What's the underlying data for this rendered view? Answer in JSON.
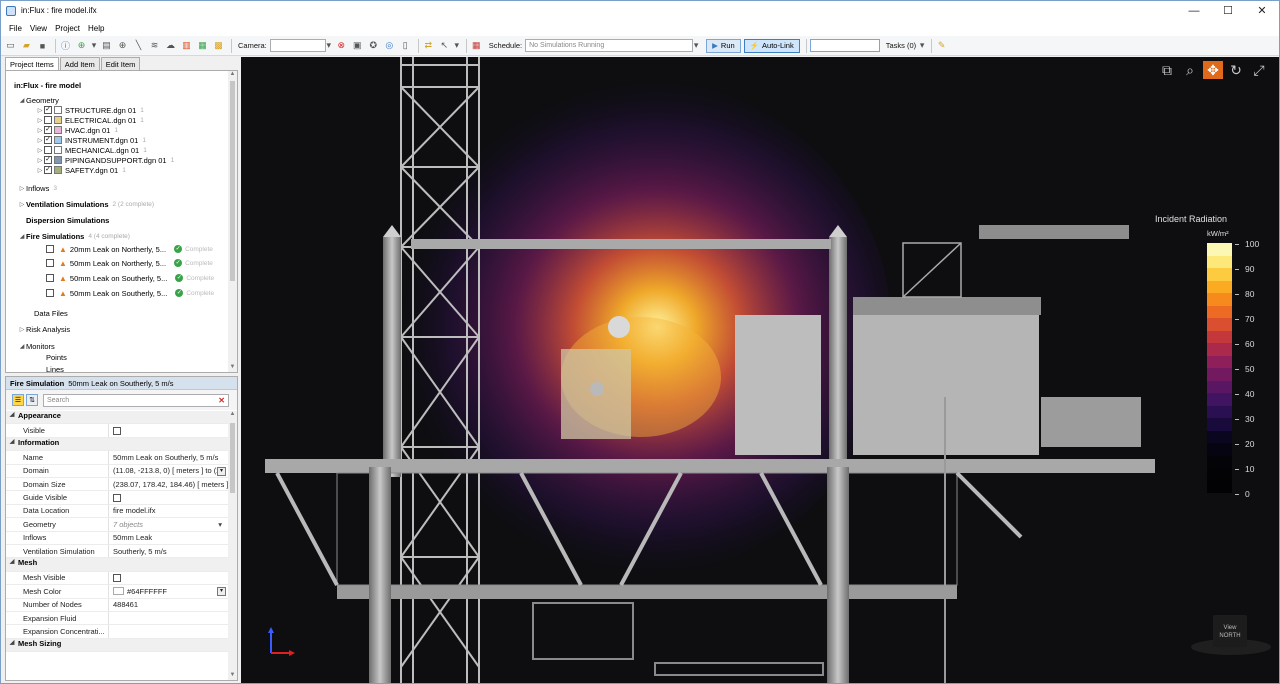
{
  "window": {
    "title": "in:Flux : fire model.ifx",
    "minimize": "—",
    "maximize": "☐",
    "close": "✕"
  },
  "menu": [
    "File",
    "View",
    "Project",
    "Help"
  ],
  "toolbar": {
    "camera_label": "Camera:",
    "schedule_label": "Schedule:",
    "schedule_value": "No Simulations Running",
    "run_label": "Run",
    "autolink_label": "Auto-Link",
    "tasks_label": "Tasks (0)"
  },
  "left_tabs": [
    "Project Items",
    "Add Item",
    "Edit Item"
  ],
  "tree": {
    "root": "in:Flux - fire model",
    "geometry_label": "Geometry",
    "geometry_items": [
      {
        "name": "STRUCTURE.dgn 01",
        "count": "1",
        "checked": true,
        "color": "#ffffff"
      },
      {
        "name": "ELECTRICAL.dgn 01",
        "count": "1",
        "checked": false,
        "color": "#e8d28a"
      },
      {
        "name": "HVAC.dgn 01",
        "count": "1",
        "checked": true,
        "color": "#e9b6d8"
      },
      {
        "name": "INSTRUMENT.dgn 01",
        "count": "1",
        "checked": true,
        "color": "#9ec9ee"
      },
      {
        "name": "MECHANICAL.dgn 01",
        "count": "1",
        "checked": false,
        "color": "#ffffff"
      },
      {
        "name": "PIPINGANDSUPPORT.dgn 01",
        "count": "1",
        "checked": true,
        "color": "#7f97b0"
      },
      {
        "name": "SAFETY.dgn 01",
        "count": "1",
        "checked": true,
        "color": "#a3b07c"
      }
    ],
    "inflows": {
      "label": "Inflows",
      "count": "3"
    },
    "ventilation": {
      "label": "Ventilation Simulations",
      "count": "2 (2 complete)"
    },
    "dispersion": {
      "label": "Dispersion Simulations"
    },
    "fire": {
      "label": "Fire Simulations",
      "count": "4 (4 complete)"
    },
    "fire_items": [
      {
        "name": "20mm Leak on Northerly, 5...",
        "status": "Complete"
      },
      {
        "name": "50mm Leak on Northerly, 5...",
        "status": "Complete"
      },
      {
        "name": "50mm Leak on Southerly, 5...",
        "status": "Complete"
      },
      {
        "name": "50mm Leak on Southerly, 5...",
        "status": "Complete"
      }
    ],
    "data_files": "Data Files",
    "risk_analysis": "Risk Analysis",
    "monitors": "Monitors",
    "points": "Points",
    "lines": "Lines"
  },
  "props": {
    "header_type": "Fire Simulation",
    "header_name": "50mm Leak on Southerly, 5 m/s",
    "search_placeholder": "Search",
    "rows": [
      {
        "type": "cat",
        "label": "Appearance"
      },
      {
        "type": "row",
        "k": "Visible",
        "kind": "check"
      },
      {
        "type": "cat",
        "label": "Information"
      },
      {
        "type": "row",
        "k": "Name",
        "v": "50mm Leak on Southerly, 5 m/s"
      },
      {
        "type": "row",
        "k": "Domain",
        "v": "(11.08, -213.8, 0) [ meters ] to (2",
        "kind": "dd"
      },
      {
        "type": "row",
        "k": "Domain Size",
        "v": "(238.07, 178.42, 184.46) [ meters ]"
      },
      {
        "type": "row",
        "k": "Guide Visible",
        "kind": "check"
      },
      {
        "type": "row",
        "k": "Data Location",
        "v": "fire model.ifx"
      },
      {
        "type": "row",
        "k": "Geometry",
        "v": "7 objects",
        "kind": "muted"
      },
      {
        "type": "row",
        "k": "Inflows",
        "v": "50mm Leak"
      },
      {
        "type": "row",
        "k": "Ventilation Simulation",
        "v": "Southerly, 5 m/s"
      },
      {
        "type": "cat",
        "label": "Mesh"
      },
      {
        "type": "row",
        "k": "Mesh Visible",
        "kind": "check"
      },
      {
        "type": "row",
        "k": "Mesh Color",
        "v": "#64FFFFFF",
        "kind": "color"
      },
      {
        "type": "row",
        "k": "Number of Nodes",
        "v": "488461"
      },
      {
        "type": "row",
        "k": "Expansion Fluid",
        "v": ""
      },
      {
        "type": "row",
        "k": "Expansion Concentrati...",
        "v": ""
      },
      {
        "type": "cat",
        "label": "Mesh Sizing"
      }
    ]
  },
  "legend": {
    "title": "Incident Radiation",
    "unit": "kW/m²",
    "ticks": [
      "100",
      "90",
      "80",
      "70",
      "60",
      "50",
      "40",
      "30",
      "20",
      "10",
      "0"
    ],
    "colors": [
      "#fdf7b4",
      "#fde97a",
      "#fccb3f",
      "#fbab22",
      "#f68a1d",
      "#ec6a22",
      "#da4f30",
      "#c4383c",
      "#ab2a4c",
      "#8f1f5a",
      "#721960",
      "#581663",
      "#401460",
      "#2a1052",
      "#180a3a",
      "#0a0620",
      "#060410",
      "#040308",
      "#030306",
      "#020204"
    ]
  },
  "viewcube": {
    "line1": "View",
    "line2": "NORTH"
  },
  "colors": {
    "accent": "#e06a1b",
    "titlebar": "#ffffff"
  }
}
